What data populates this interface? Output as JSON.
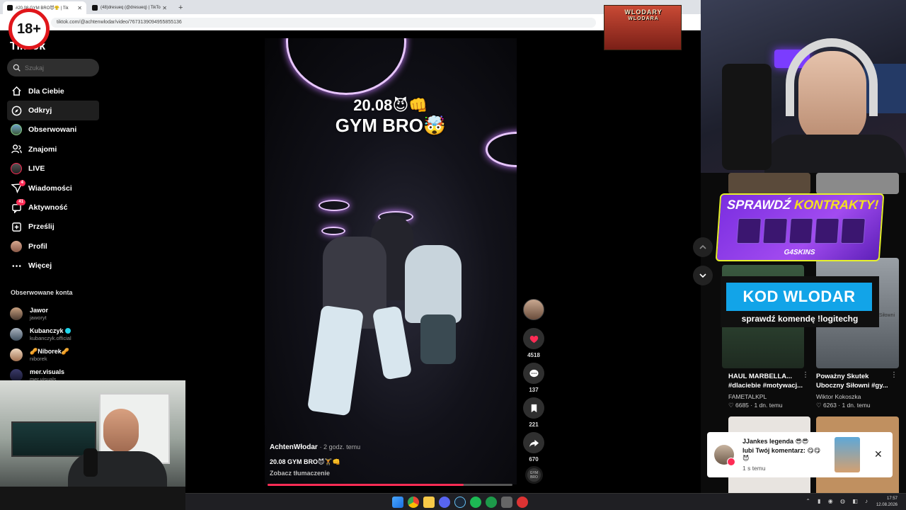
{
  "browser": {
    "tabs": [
      {
        "title": "#20.08 GYM BRO😈😤 | Tik",
        "active": true
      },
      {
        "title": "(48)dresueq (@dresueq) | TikTo",
        "active": false
      }
    ],
    "new_tab": "+",
    "url": "tiktok.com/@achtenwlodar/video/7673139094955855136"
  },
  "age_badge": "18+",
  "tiktok": {
    "logo": "TikTok",
    "search_placeholder": "Szukaj",
    "nav": [
      {
        "label": "Dla Ciebie",
        "icon": "home-icon"
      },
      {
        "label": "Odkryj",
        "icon": "compass-icon",
        "selected": true
      },
      {
        "label": "Obserwowani",
        "icon": "following-avatar-icon"
      },
      {
        "label": "Znajomi",
        "icon": "friends-icon"
      },
      {
        "label": "LIVE",
        "icon": "live-icon"
      },
      {
        "label": "Wiadomości",
        "icon": "messages-icon",
        "badge": "4"
      },
      {
        "label": "Aktywność",
        "icon": "activity-icon",
        "badge": "41"
      },
      {
        "label": "Prześlij",
        "icon": "upload-icon"
      },
      {
        "label": "Profil",
        "icon": "profile-avatar-icon"
      },
      {
        "label": "Więcej",
        "icon": "more-dots-icon"
      }
    ],
    "followed_heading": "Obserwowane konta",
    "followed": [
      {
        "name": "Jawor",
        "handle": "jaworyt"
      },
      {
        "name": "Kubanczyk",
        "handle": "kubanczyk.official",
        "verified": true
      },
      {
        "name": "🥜Niborek🥜",
        "handle": "niborek"
      },
      {
        "name": "mer.visuals",
        "handle": "mer.visuals"
      }
    ]
  },
  "video": {
    "overlay_line1": "20.08😈👊",
    "overlay_line2": "GYM BRO🤯",
    "author": "AchtenWłodar",
    "time_ago": "· 2 godz. temu",
    "caption": "20.08 GYM BRO😈🏋️👊",
    "translate": "Zobacz tłumaczenie",
    "progress": 0.8,
    "likes": "4518",
    "comments": "137",
    "saves": "221",
    "shares": "670",
    "music_disc_text": "GYM BRO"
  },
  "overlays": {
    "wlodary_line1": "WLODARY",
    "wlodary_line2": "WLODARA",
    "promo_title_a": "SPRAWDŹ",
    "promo_title_b": "KONTRAKTY!",
    "promo_brand": "G4SKINS",
    "kod": "KOD WLODAR",
    "kod_sub": "sprawdź komendę !logitechg"
  },
  "recommendations": [
    {
      "title": "HAUL MARBELLA... #dlaciebie #motywacj...",
      "author": "FAMETALKPL",
      "views": "6685",
      "age": "1 dn. temu"
    },
    {
      "title": "Poważny Skutek Uboczny Siłowni #gy...",
      "author": "Wiktor Kokoszka",
      "views": "6263",
      "age": "1 dn. temu",
      "thumb_text": "Poważny Skutek Uboczny Siłowni"
    }
  ],
  "notification": {
    "line1": "JJankes legenda 😎😎",
    "line2": "lubi Twój komentarz: 😋😋",
    "line2b": "😈",
    "time": "1 s temu",
    "close": "✕"
  },
  "taskbar": {
    "time": "17:57",
    "date": "12.08.2026"
  },
  "colors": {
    "tiktok_red": "#fe2c55",
    "promo_purple": "#a24bf0",
    "kod_blue": "#12a4e8"
  }
}
